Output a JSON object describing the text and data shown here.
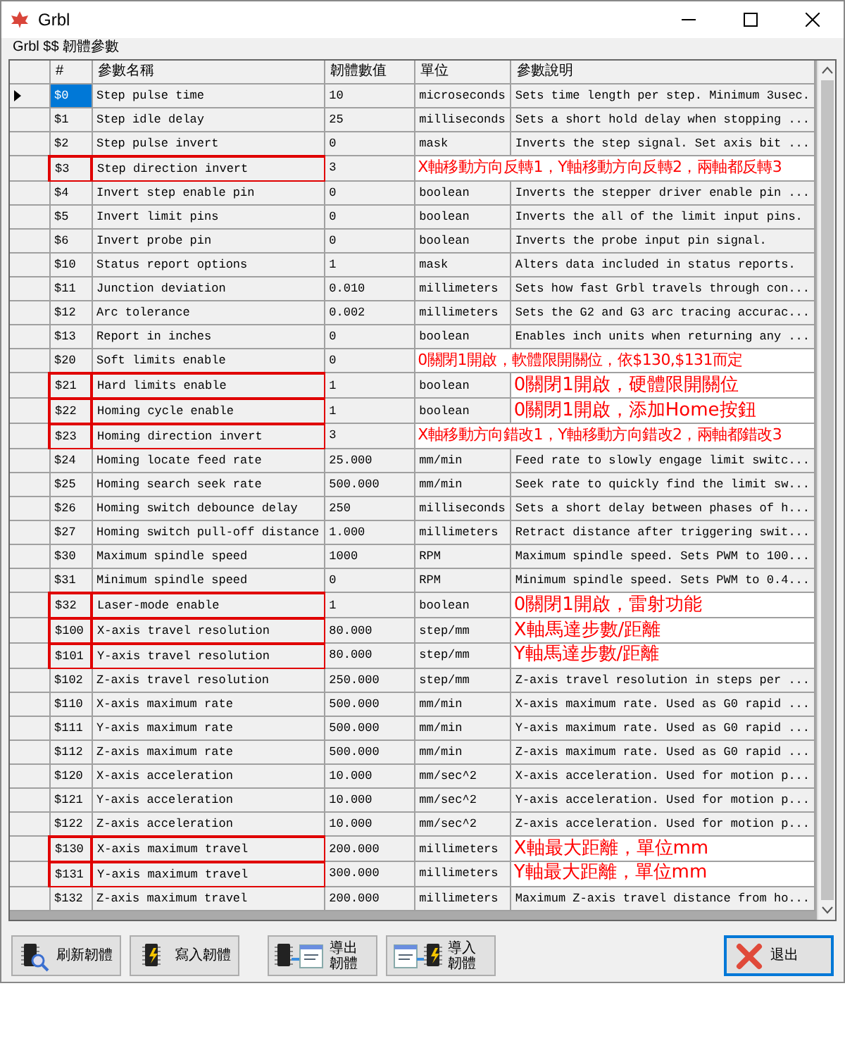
{
  "window": {
    "title": "Grbl"
  },
  "group_label": "Grbl $$ 韌體參數",
  "table": {
    "columns": [
      "#",
      "參數名稱",
      "韌體數值",
      "單位",
      "參數說明"
    ],
    "rows": [
      {
        "number": "$0",
        "name": "Step pulse time",
        "value": "10",
        "unit": "microseconds",
        "description": "Sets time length per step. Minimum 3usec.",
        "selected": true,
        "highlighted": false
      },
      {
        "number": "$1",
        "name": "Step idle delay",
        "value": "25",
        "unit": "milliseconds",
        "description": "Sets a short hold delay when stopping ...",
        "selected": false,
        "highlighted": false
      },
      {
        "number": "$2",
        "name": "Step pulse invert",
        "value": "0",
        "unit": "mask",
        "description": "Inverts the step signal. Set axis bit ...",
        "selected": false,
        "highlighted": false
      },
      {
        "number": "$3",
        "name": "Step direction invert",
        "value": "3",
        "annotation": "X軸移動方向反轉1，Y軸移動方向反轉2，兩軸都反轉3",
        "selected": false,
        "highlighted": true
      },
      {
        "number": "$4",
        "name": "Invert step enable pin",
        "value": "0",
        "unit": "boolean",
        "description": "Inverts the stepper driver enable pin ...",
        "selected": false,
        "highlighted": false
      },
      {
        "number": "$5",
        "name": "Invert limit pins",
        "value": "0",
        "unit": "boolean",
        "description": "Inverts the all of the limit input pins.",
        "selected": false,
        "highlighted": false
      },
      {
        "number": "$6",
        "name": "Invert probe pin",
        "value": "0",
        "unit": "boolean",
        "description": "Inverts the probe input pin signal.",
        "selected": false,
        "highlighted": false
      },
      {
        "number": "$10",
        "name": "Status report options",
        "value": "1",
        "unit": "mask",
        "description": "Alters data included in status reports.",
        "selected": false,
        "highlighted": false
      },
      {
        "number": "$11",
        "name": "Junction deviation",
        "value": "0.010",
        "unit": "millimeters",
        "description": "Sets how fast Grbl travels through con...",
        "selected": false,
        "highlighted": false
      },
      {
        "number": "$12",
        "name": "Arc tolerance",
        "value": "0.002",
        "unit": "millimeters",
        "description": "Sets the G2 and G3 arc tracing accurac...",
        "selected": false,
        "highlighted": false
      },
      {
        "number": "$13",
        "name": "Report in inches",
        "value": "0",
        "unit": "boolean",
        "description": "Enables inch units when returning any ...",
        "selected": false,
        "highlighted": false
      },
      {
        "number": "$20",
        "name": "Soft limits enable",
        "value": "0",
        "annotation": "0關閉1開啟，軟體限開關位，依$130,$131而定",
        "selected": false,
        "highlighted": false
      },
      {
        "number": "$21",
        "name": "Hard limits enable",
        "value": "1",
        "unit": "boolean",
        "annotation": "0關閉1開啟，硬體限開關位",
        "selected": false,
        "highlighted": true
      },
      {
        "number": "$22",
        "name": "Homing cycle enable",
        "value": "1",
        "unit": "boolean",
        "annotation": "0關閉1開啟，添加Home按鈕",
        "selected": false,
        "highlighted": true
      },
      {
        "number": "$23",
        "name": "Homing direction invert",
        "value": "3",
        "annotation": "X軸移動方向錯改1，Y軸移動方向錯改2，兩軸都錯改3",
        "selected": false,
        "highlighted": true
      },
      {
        "number": "$24",
        "name": "Homing locate feed rate",
        "value": "25.000",
        "unit": "mm/min",
        "description": "Feed rate to slowly engage limit switc...",
        "selected": false,
        "highlighted": false
      },
      {
        "number": "$25",
        "name": "Homing search seek rate",
        "value": "500.000",
        "unit": "mm/min",
        "description": "Seek rate to quickly find the limit sw...",
        "selected": false,
        "highlighted": false
      },
      {
        "number": "$26",
        "name": "Homing switch debounce delay",
        "value": "250",
        "unit": "milliseconds",
        "description": "Sets a short delay between phases of h...",
        "selected": false,
        "highlighted": false
      },
      {
        "number": "$27",
        "name": "Homing switch pull-off distance",
        "value": "1.000",
        "unit": "millimeters",
        "description": "Retract distance after triggering swit...",
        "selected": false,
        "highlighted": false
      },
      {
        "number": "$30",
        "name": "Maximum spindle speed",
        "value": "1000",
        "unit": "RPM",
        "description": "Maximum spindle speed. Sets PWM to 100...",
        "selected": false,
        "highlighted": false
      },
      {
        "number": "$31",
        "name": "Minimum spindle speed",
        "value": "0",
        "unit": "RPM",
        "description": "Minimum spindle speed. Sets PWM to 0.4...",
        "selected": false,
        "highlighted": false
      },
      {
        "number": "$32",
        "name": "Laser-mode enable",
        "value": "1",
        "unit": "boolean",
        "annotation": "0關閉1開啟，雷射功能",
        "selected": false,
        "highlighted": true
      },
      {
        "number": "$100",
        "name": "X-axis travel resolution",
        "value": "80.000",
        "unit": "step/mm",
        "annotation": "X軸馬達步數/距離",
        "selected": false,
        "highlighted": true
      },
      {
        "number": "$101",
        "name": "Y-axis travel resolution",
        "value": "80.000",
        "unit": "step/mm",
        "annotation": "Y軸馬達步數/距離",
        "selected": false,
        "highlighted": true
      },
      {
        "number": "$102",
        "name": "Z-axis travel resolution",
        "value": "250.000",
        "unit": "step/mm",
        "description": "Z-axis travel resolution in steps per ...",
        "selected": false,
        "highlighted": false
      },
      {
        "number": "$110",
        "name": "X-axis maximum rate",
        "value": "500.000",
        "unit": "mm/min",
        "description": "X-axis maximum rate. Used as G0 rapid ...",
        "selected": false,
        "highlighted": false
      },
      {
        "number": "$111",
        "name": "Y-axis maximum rate",
        "value": "500.000",
        "unit": "mm/min",
        "description": "Y-axis maximum rate. Used as G0 rapid ...",
        "selected": false,
        "highlighted": false
      },
      {
        "number": "$112",
        "name": "Z-axis maximum rate",
        "value": "500.000",
        "unit": "mm/min",
        "description": "Z-axis maximum rate. Used as G0 rapid ...",
        "selected": false,
        "highlighted": false
      },
      {
        "number": "$120",
        "name": "X-axis acceleration",
        "value": "10.000",
        "unit": "mm/sec^2",
        "description": "X-axis acceleration. Used for motion p...",
        "selected": false,
        "highlighted": false
      },
      {
        "number": "$121",
        "name": "Y-axis acceleration",
        "value": "10.000",
        "unit": "mm/sec^2",
        "description": "Y-axis acceleration. Used for motion p...",
        "selected": false,
        "highlighted": false
      },
      {
        "number": "$122",
        "name": "Z-axis acceleration",
        "value": "10.000",
        "unit": "mm/sec^2",
        "description": "Z-axis acceleration. Used for motion p...",
        "selected": false,
        "highlighted": false
      },
      {
        "number": "$130",
        "name": "X-axis maximum travel",
        "value": "200.000",
        "unit": "millimeters",
        "annotation": "X軸最大距離，單位mm",
        "selected": false,
        "highlighted": true
      },
      {
        "number": "$131",
        "name": "Y-axis maximum travel",
        "value": "300.000",
        "unit": "millimeters",
        "annotation": "Y軸最大距離，單位mm",
        "selected": false,
        "highlighted": true
      },
      {
        "number": "$132",
        "name": "Z-axis maximum travel",
        "value": "200.000",
        "unit": "millimeters",
        "description": "Maximum Z-axis travel distance from ho...",
        "selected": false,
        "highlighted": false
      }
    ]
  },
  "buttons": [
    {
      "kind": "refresh",
      "label": "刷新韌體"
    },
    {
      "kind": "write",
      "label": "寫入韌體"
    },
    {
      "kind": "export",
      "label": "導出韌體"
    },
    {
      "kind": "import",
      "label": "導入韌體"
    },
    {
      "kind": "exit",
      "label": "退出"
    }
  ]
}
